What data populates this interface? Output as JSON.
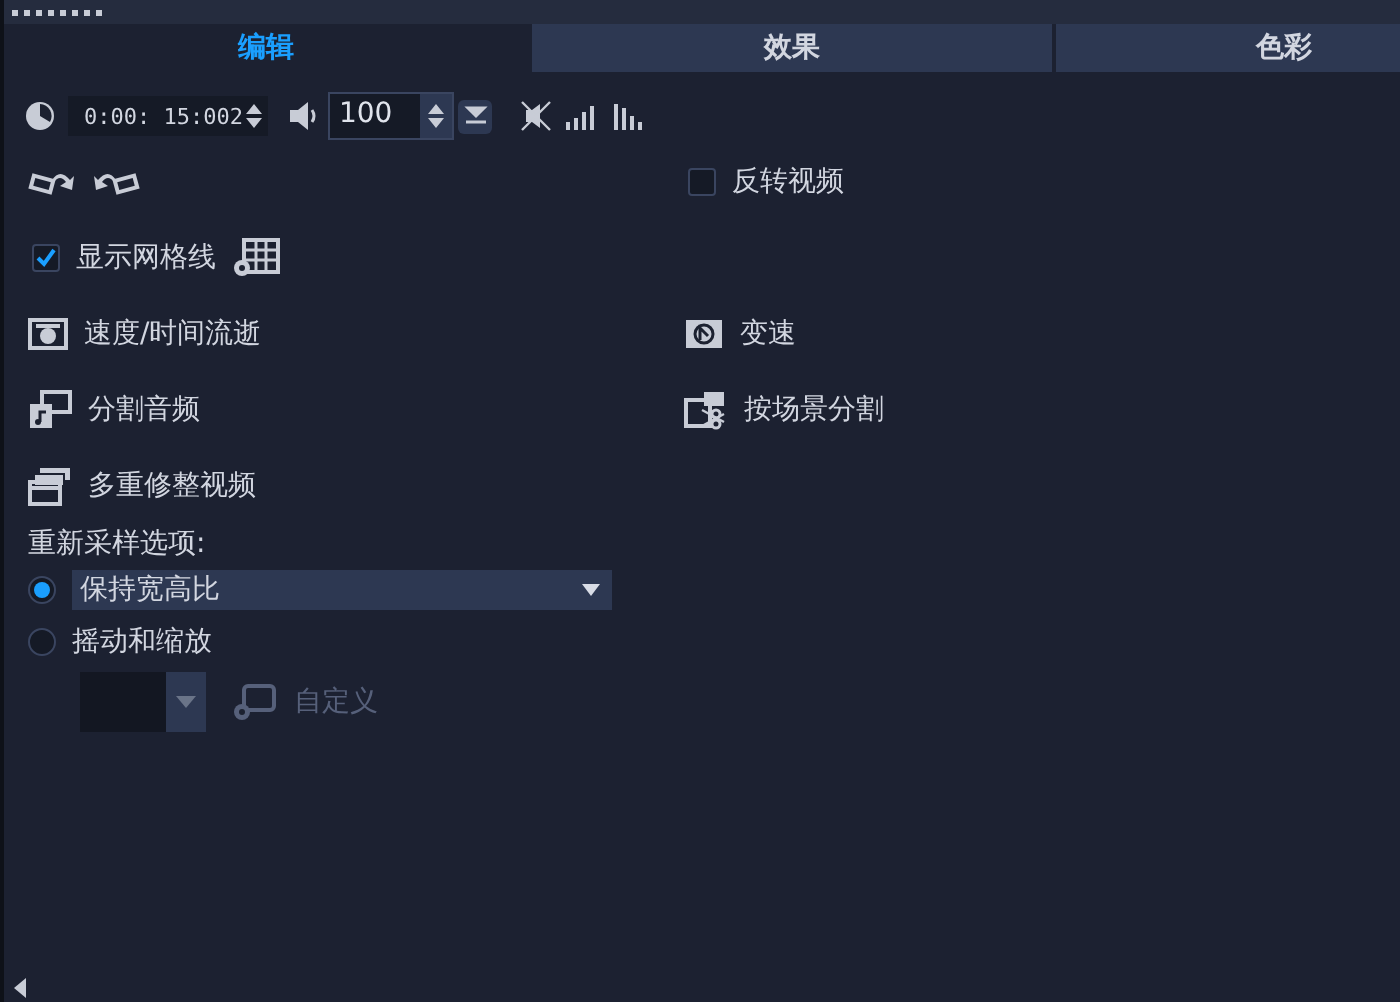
{
  "tabs": [
    {
      "label": "编辑",
      "selected": true
    },
    {
      "label": "效果",
      "selected": false
    },
    {
      "label": "色彩",
      "selected": false
    }
  ],
  "toolbar": {
    "time": "0:00: 15:002",
    "volume": "100"
  },
  "flip_video": {
    "label": "反转视频",
    "checked": false
  },
  "show_grid": {
    "label": "显示网格线",
    "checked": true
  },
  "actions": [
    {
      "kind": "speed",
      "label": "速度/时间流逝"
    },
    {
      "kind": "variable-speed",
      "label": "变速"
    },
    {
      "kind": "split-audio",
      "label": "分割音频"
    },
    {
      "kind": "scene-split",
      "label": "按场景分割"
    },
    {
      "kind": "multi-trim",
      "label": "多重修整视频"
    }
  ],
  "resample": {
    "label": "重新采样选项:",
    "options": [
      {
        "kind": "dropdown",
        "value": "保持宽高比",
        "selected": true
      },
      {
        "kind": "label",
        "label": "摇动和缩放",
        "selected": false
      }
    ],
    "custom": {
      "label": "自定义",
      "disabled": true
    }
  }
}
